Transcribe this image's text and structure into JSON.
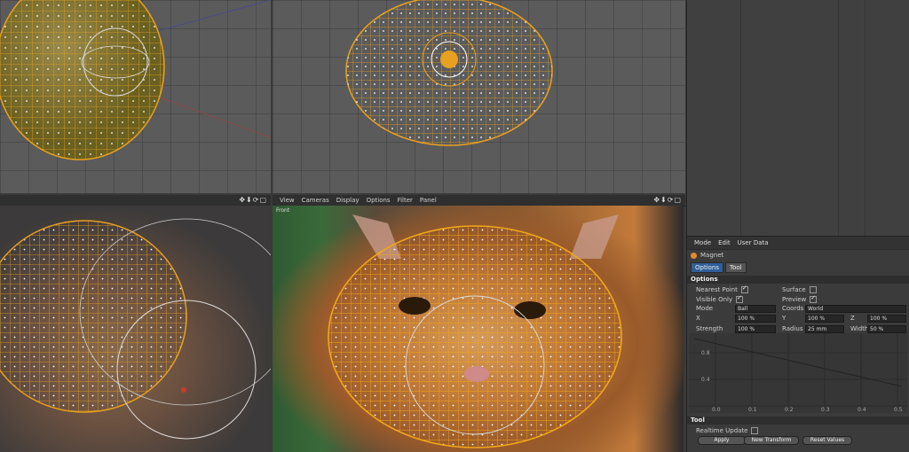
{
  "viewport_front": {
    "menu": [
      "View",
      "Cameras",
      "Display",
      "Options",
      "Filter",
      "Panel"
    ],
    "label": "Front"
  },
  "attributes": {
    "menu": [
      "Mode",
      "Edit",
      "User Data"
    ],
    "tool_name": "Magnet",
    "tabs": [
      "Options",
      "Tool"
    ],
    "options_section": "Options",
    "nearest_point": "Nearest Point",
    "visible_only": "Visible Only",
    "surface": "Surface",
    "preview": "Preview",
    "mode_label": "Mode",
    "mode_value": "Ball",
    "coords_label": "Coords",
    "coords_value": "World",
    "x_label": "X",
    "x_value": "100 %",
    "y_label": "Y",
    "y_value": "100 %",
    "z_label": "Z",
    "z_value": "100 %",
    "strength_label": "Strength",
    "strength_value": "100 %",
    "radius_label": "Radius",
    "radius_value": "25 mm",
    "width_label": "Width",
    "width_value": "50 %",
    "graph_y_ticks": [
      "0.8",
      "0.4"
    ],
    "graph_x_ticks": [
      "0.0",
      "0.1",
      "0.2",
      "0.3",
      "0.4",
      "0.5"
    ],
    "tool_section": "Tool",
    "realtime_update": "Realtime Update",
    "apply_btn": "Apply",
    "new_transform_btn": "New Transform",
    "reset_values_btn": "Reset Values"
  },
  "colors": {
    "mesh": "#e8a020",
    "accent_tab": "#2f5f9a"
  }
}
